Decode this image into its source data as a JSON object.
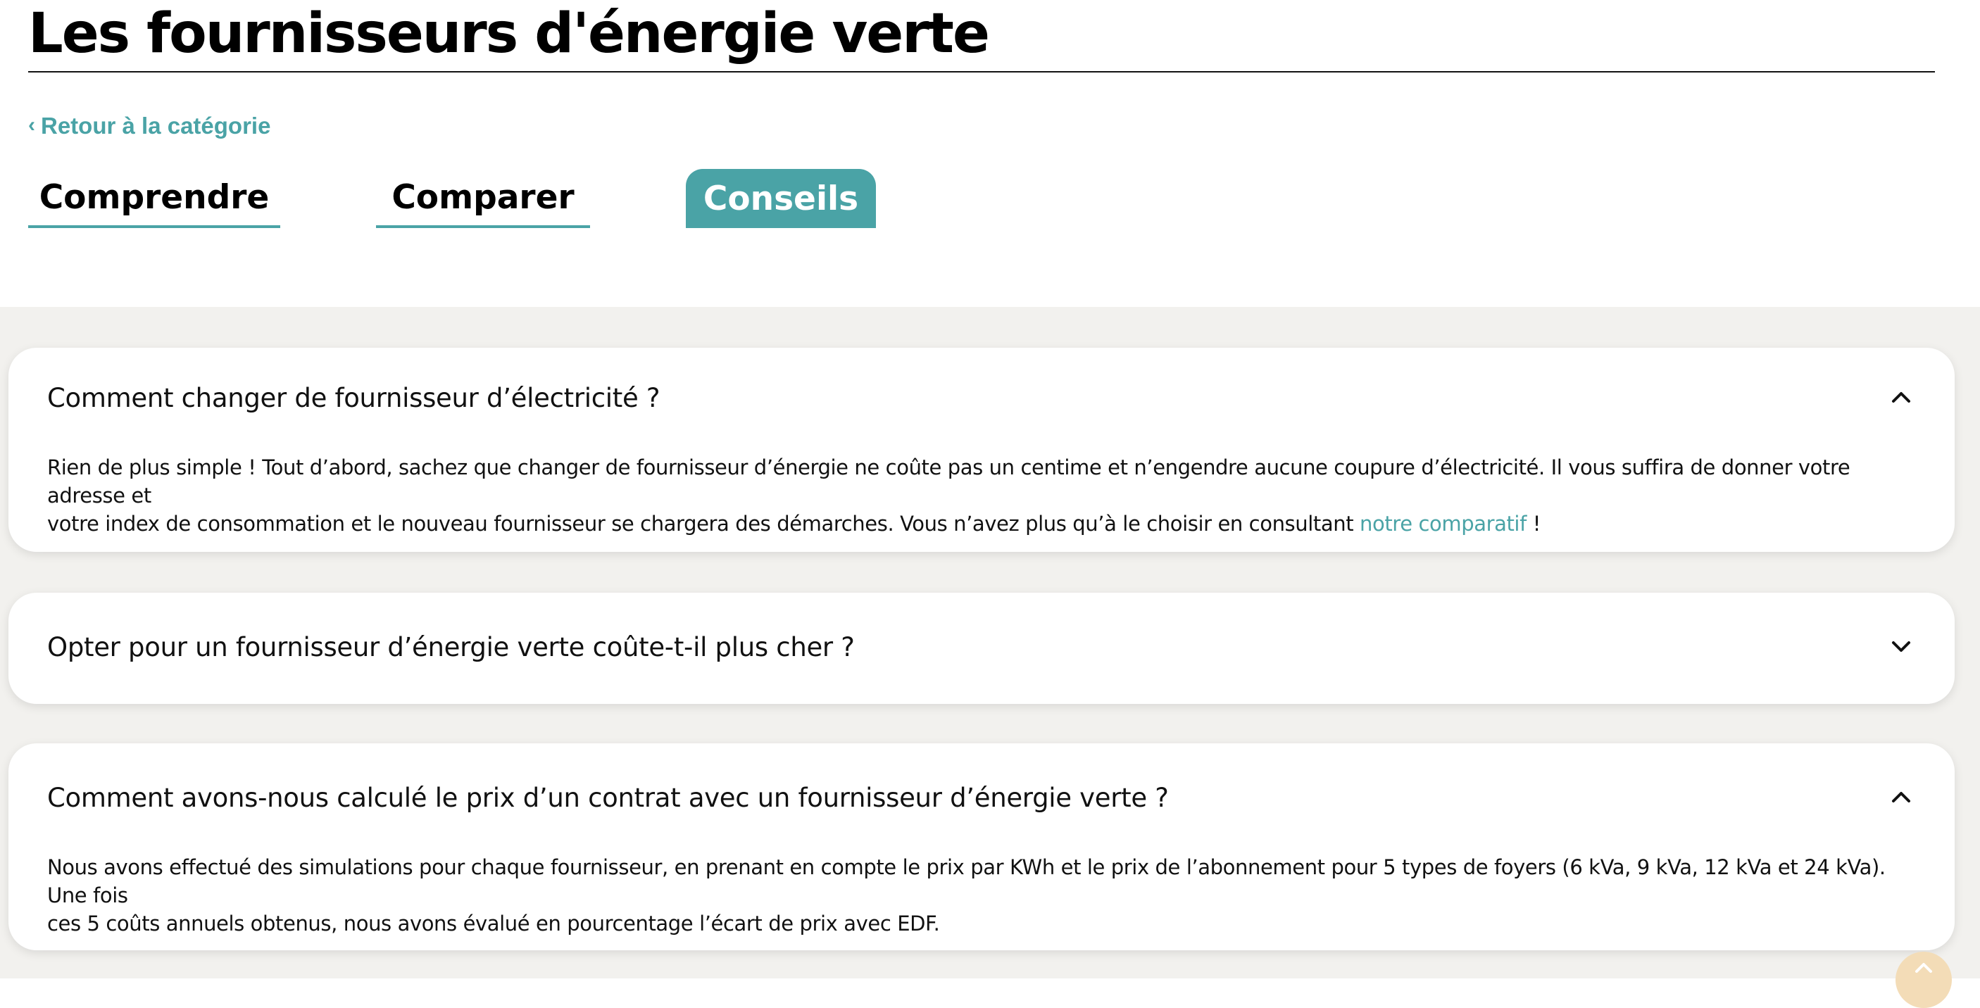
{
  "header": {
    "title": "Les fournisseurs d'énergie verte",
    "back_link": "Retour à la catégorie"
  },
  "tabs": [
    {
      "label": "Comprendre",
      "active": false
    },
    {
      "label": "Comparer",
      "active": false
    },
    {
      "label": "Conseils",
      "active": true
    }
  ],
  "faq": [
    {
      "question": "Comment changer de fournisseur d’électricité ?",
      "expanded": true,
      "answer_line1": "Rien de plus simple ! Tout d’abord, sachez que changer de fournisseur d’énergie ne coûte pas un centime et n’engendre aucune coupure d’électricité. Il vous suffira de donner votre adresse et",
      "answer_line2": "votre index de consommation et le nouveau fournisseur se chargera des démarches. Vous n’avez plus qu’à le choisir en consultant ",
      "answer_link": "notre comparatif",
      "answer_end": " !"
    },
    {
      "question": "Opter pour un fournisseur d’énergie verte coûte-t-il plus cher ?",
      "expanded": false
    },
    {
      "question": "Comment avons-nous calculé le prix d’un contrat avec un fournisseur d’énergie verte ?",
      "expanded": true,
      "answer_line1": "Nous avons effectué des simulations pour chaque fournisseur, en prenant en compte le prix par KWh et le prix de l’abonnement pour 5 types de foyers (6 kVa, 9 kVa, 12 kVa et 24 kVa). Une fois",
      "answer_line2": "ces 5 coûts annuels obtenus, nous avons évalué en pourcentage l’écart de prix avec EDF."
    }
  ],
  "colors": {
    "accent": "#4aa3a6",
    "background": "#f2f1ee",
    "scroll_button": "#f3dcb7"
  }
}
